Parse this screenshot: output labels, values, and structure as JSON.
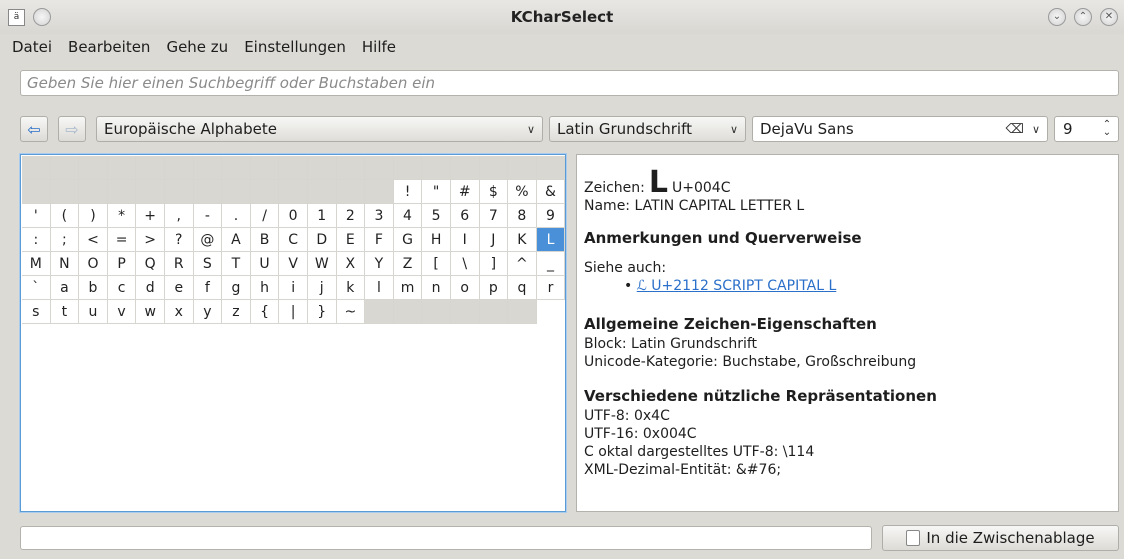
{
  "window": {
    "title": "KCharSelect",
    "icon": "a-icon",
    "controls": [
      "minimize-icon",
      "maximize-icon",
      "close-icon"
    ]
  },
  "menu": [
    {
      "label": "Datei"
    },
    {
      "label": "Bearbeiten"
    },
    {
      "label": "Gehe zu"
    },
    {
      "label": "Einstellungen"
    },
    {
      "label": "Hilfe"
    }
  ],
  "search": {
    "value": "",
    "placeholder": "Geben Sie hier einen Suchbegriff oder Buchstaben ein"
  },
  "toolbar": {
    "script": "Europäische Alphabete",
    "block": "Latin Grundschrift",
    "font": "DejaVu Sans",
    "size": "9"
  },
  "grid": {
    "columns": 19,
    "cells": [
      "",
      "",
      "",
      "",
      "",
      "",
      "",
      "",
      "",
      "",
      "",
      "",
      "",
      "",
      "",
      "",
      "",
      "",
      "",
      "",
      "",
      "",
      "",
      "",
      "",
      "",
      "",
      "",
      "",
      "",
      "",
      "",
      "!",
      "\"",
      "#",
      "$",
      "%",
      "&",
      "'",
      "(",
      ")",
      "*",
      "+",
      ",",
      "-",
      ".",
      "/",
      "0",
      "1",
      "2",
      "3",
      "4",
      "5",
      "6",
      "7",
      "8",
      "9",
      ":",
      ";",
      "<",
      "=",
      ">",
      "?",
      "@",
      "A",
      "B",
      "C",
      "D",
      "E",
      "F",
      "G",
      "H",
      "I",
      "J",
      "K",
      "L",
      "M",
      "N",
      "O",
      "P",
      "Q",
      "R",
      "S",
      "T",
      "U",
      "V",
      "W",
      "X",
      "Y",
      "Z",
      "[",
      "\\",
      "]",
      "^",
      "_",
      "`",
      "a",
      "b",
      "c",
      "d",
      "e",
      "f",
      "g",
      "h",
      "i",
      "j",
      "k",
      "l",
      "m",
      "n",
      "o",
      "p",
      "q",
      "r",
      "s",
      "t",
      "u",
      "v",
      "w",
      "x",
      "y",
      "z",
      "{",
      "|",
      "}",
      "~",
      "",
      "",
      "",
      "",
      "",
      ""
    ],
    "selected": "L"
  },
  "info": {
    "char_label": "Zeichen:",
    "char": "L",
    "code": "U+004C",
    "name": "Name: LATIN CAPITAL LETTER L",
    "h_notes": "Anmerkungen und Querverweise",
    "see_also": "Siehe auch:",
    "see_also_link": "ℒ U+2112 SCRIPT CAPITAL L",
    "h_general": "Allgemeine Zeichen-Eigenschaften",
    "block": "Block: Latin Grundschrift",
    "category": "Unicode-Kategorie: Buchstabe, Großschreibung",
    "h_repr": "Verschiedene nützliche Repräsentationen",
    "utf8": "UTF-8: 0x4C",
    "utf16": "UTF-16: 0x004C",
    "octal": "C oktal dargestelltes UTF-8: \\114",
    "xml": "XML-Dezimal-Entität: &#76;"
  },
  "bottom": {
    "copy_button": "In die Zwischenablage"
  }
}
